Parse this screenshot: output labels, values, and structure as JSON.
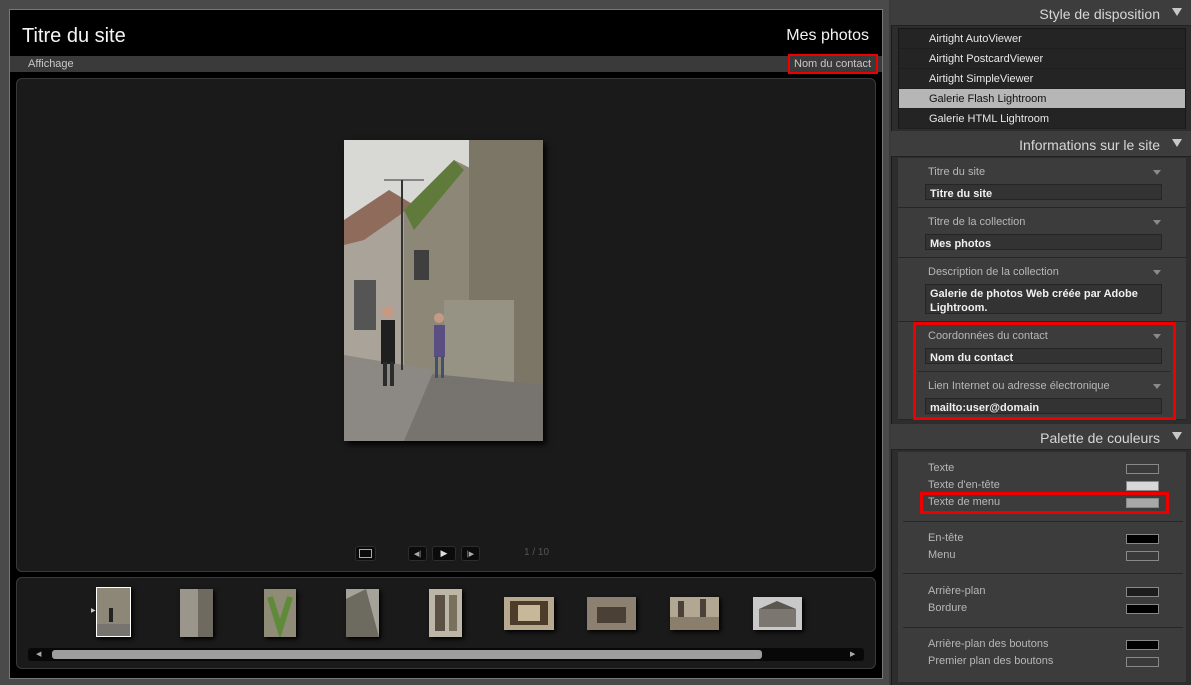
{
  "preview": {
    "site_title": "Titre du site",
    "collection_title": "Mes photos",
    "menu_view": "Affichage",
    "menu_contact": "Nom du contact",
    "page_indicator": "1 / 10",
    "thumbnail_count": 9,
    "selected_thumbnail": 1
  },
  "panel": {
    "layout_section": {
      "title": "Style de disposition",
      "items": [
        {
          "label": "Airtight AutoViewer",
          "selected": false
        },
        {
          "label": "Airtight PostcardViewer",
          "selected": false
        },
        {
          "label": "Airtight SimpleViewer",
          "selected": false
        },
        {
          "label": "Galerie Flash Lightroom",
          "selected": true
        },
        {
          "label": "Galerie HTML Lightroom",
          "selected": false
        }
      ]
    },
    "site_info": {
      "title": "Informations sur le site",
      "fields": [
        {
          "label": "Titre du site",
          "value": "Titre du site"
        },
        {
          "label": "Titre de la collection",
          "value": "Mes photos"
        },
        {
          "label": "Description de la collection",
          "value": "Galerie de photos Web créée par Adobe Lightroom."
        },
        {
          "label": "Coordonnées du contact",
          "value": "Nom du contact"
        },
        {
          "label": "Lien Internet ou adresse électronique",
          "value": "mailto:user@domain"
        }
      ]
    },
    "color_palette": {
      "title": "Palette de couleurs",
      "items": [
        {
          "label": "Texte",
          "color": "#3a3a3a"
        },
        {
          "label": "Texte d'en-tête",
          "color": "#d8d8d8"
        },
        {
          "label": "Texte de menu",
          "color": "#a8a8a8"
        },
        {
          "label": "En-tête",
          "color": "#000000"
        },
        {
          "label": "Menu",
          "color": "#3a3a3a"
        },
        {
          "label": "Arrière-plan",
          "color": "#1c1c1c"
        },
        {
          "label": "Bordure",
          "color": "#000000"
        },
        {
          "label": "Arrière-plan des boutons",
          "color": "#000000"
        },
        {
          "label": "Premier plan des boutons",
          "color": "#3a3a3a"
        }
      ]
    }
  }
}
